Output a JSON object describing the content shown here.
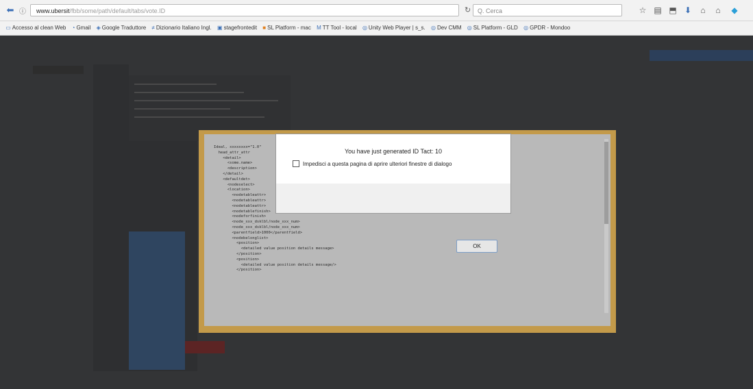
{
  "browser": {
    "url_host": "www.ubersit",
    "url_path": "/fbb/some/path/default/tabs/vote.ID",
    "search_placeholder": "Q. Cerca",
    "reload_label": "↻"
  },
  "bookmarks": [
    {
      "label": "Accesso al clean Web"
    },
    {
      "label": "Gmail"
    },
    {
      "label": "Google Traduttore"
    },
    {
      "label": "Dizionario Italiano Ingl."
    },
    {
      "label": "stagefrontedit"
    },
    {
      "label": "SL Platform - mac"
    },
    {
      "label": "TT Tool - local"
    },
    {
      "label": "Unity Web Player | s_s."
    },
    {
      "label": "Dev CMM"
    },
    {
      "label": "SL Platform - GLD"
    },
    {
      "label": "GPDR - Mondoo"
    }
  ],
  "dialog": {
    "title": "You have just generated ID Tact: 10",
    "checkbox_label": "Impedisci a questa pagina di aprire ulteriori finestre di dialogo",
    "ok_label": "OK"
  },
  "code_lines": [
    "Ideal, xxxxxxxx=\"1.0\"",
    "  head_attr_attr",
    "    <detail>",
    "      <some.name>",
    "      <description>",
    "    </detail>",
    "    <defaultdet>",
    "      <nodeselect>",
    "      <location>",
    "        <nodetableattr>",
    "        <nodetableattr>",
    "        <nodetableattr>",
    "        <nodetablefinish>",
    "        <nodeforfinish>",
    "        <node_xxx_dsklbl/node_xxx_num>",
    "        <node_xxx_dsklbl/node_xxx_num>",
    "        <parentfield>1000</parentfield>",
    "        <nodebelonglist>",
    "          <position>",
    "            <detailed value position details message>",
    "          </position>",
    "          <position>",
    "            <detailed value position details message/>",
    "          </position>"
  ],
  "colors": {
    "modal_frame": "#c39a4a",
    "page_bg": "#333436"
  }
}
